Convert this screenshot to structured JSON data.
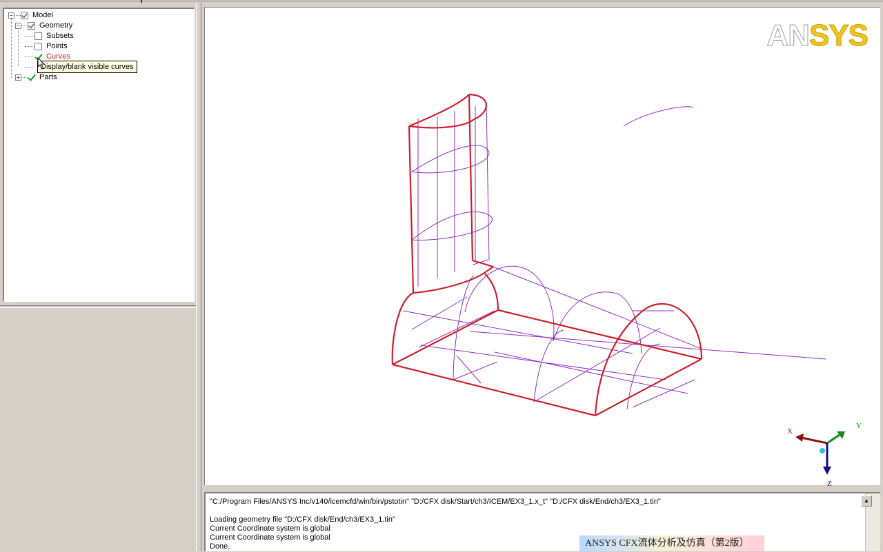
{
  "tree": {
    "model_label": "Model",
    "geometry_label": "Geometry",
    "subsets_label": "Subsets",
    "points_label": "Points",
    "curves_label": "Curves",
    "parts_label": "Parts",
    "tooltip": "Display/blank visible curves"
  },
  "viewport": {
    "logo_left": "AN",
    "logo_right": "SYS",
    "axis_x": "X",
    "axis_y": "Y",
    "axis_z": "Z",
    "colors": {
      "edges": "#cc2030",
      "wire": "#9030c0",
      "axis_x": "#8b1010",
      "axis_y": "#1a8a1a",
      "axis_z": "#101080",
      "accent": "#f0c419"
    }
  },
  "console": {
    "lines": [
      "\"C:/Program Files/ANSYS Inc/v140/icemcfd/win/bin/pstotin\" \"D:/CFX disk/Start/ch3/ICEM/EX3_1.x_t\" \"D:/CFX disk/End/ch3/EX3_1.tin\"",
      "",
      "Loading geometry file \"D:/CFX disk/End/ch3/EX3_1.tin\"",
      "Current Coordinate system is global",
      "Current Coordinate system is global",
      "Done."
    ]
  },
  "watermark": "ANSYS CFX流体分析及仿真（第2版）"
}
